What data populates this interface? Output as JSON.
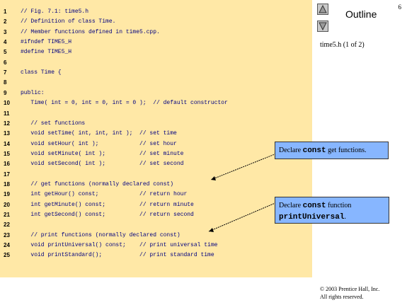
{
  "slide_number": "6",
  "outline": {
    "title": "Outline",
    "subtitle": "time5.h (1 of 2)",
    "up_icon": "triangle-up-icon",
    "down_icon": "triangle-down-icon"
  },
  "code_lines": [
    {
      "num": "1",
      "text": "// Fig. 7.1: time5.h"
    },
    {
      "num": "2",
      "text": "// Definition of class Time."
    },
    {
      "num": "3",
      "text": "// Member functions defined in time5.cpp."
    },
    {
      "num": "4",
      "text": "#ifndef TIME5_H"
    },
    {
      "num": "5",
      "text": "#define TIME5_H"
    },
    {
      "num": "6",
      "text": ""
    },
    {
      "num": "7",
      "text": "class Time {"
    },
    {
      "num": "8",
      "text": ""
    },
    {
      "num": "9",
      "text": "public:"
    },
    {
      "num": "10",
      "text": "   Time( int = 0, int = 0, int = 0 );  // default constructor"
    },
    {
      "num": "11",
      "text": ""
    },
    {
      "num": "12",
      "text": "   // set functions"
    },
    {
      "num": "13",
      "text": "   void setTime( int, int, int );  // set time"
    },
    {
      "num": "14",
      "text": "   void setHour( int );            // set hour"
    },
    {
      "num": "15",
      "text": "   void setMinute( int );          // set minute"
    },
    {
      "num": "16",
      "text": "   void setSecond( int );          // set second"
    },
    {
      "num": "17",
      "text": ""
    },
    {
      "num": "18",
      "text": "   // get functions (normally declared const)"
    },
    {
      "num": "19",
      "text": "   int getHour() const;            // return hour"
    },
    {
      "num": "20",
      "text": "   int getMinute() const;          // return minute"
    },
    {
      "num": "21",
      "text": "   int getSecond() const;          // return second"
    },
    {
      "num": "22",
      "text": ""
    },
    {
      "num": "23",
      "text": "   // print functions (normally declared const)"
    },
    {
      "num": "24",
      "text": "   void printUniversal() const;    // print universal time"
    },
    {
      "num": "25",
      "text": "   void printStandard();           // print standard time"
    }
  ],
  "callouts": {
    "first": {
      "pre": "Declare ",
      "code": "const",
      "post": " get functions."
    },
    "second": {
      "pre": "Declare ",
      "code": "const",
      "mid": " function",
      "code2": "printUniversal",
      "post": "."
    }
  },
  "copyright": {
    "line1": "© 2003 Prentice Hall, Inc.",
    "line2": "All rights reserved."
  },
  "colors": {
    "code_background": "#ffe8a6",
    "callout_background": "#87b6ff"
  }
}
